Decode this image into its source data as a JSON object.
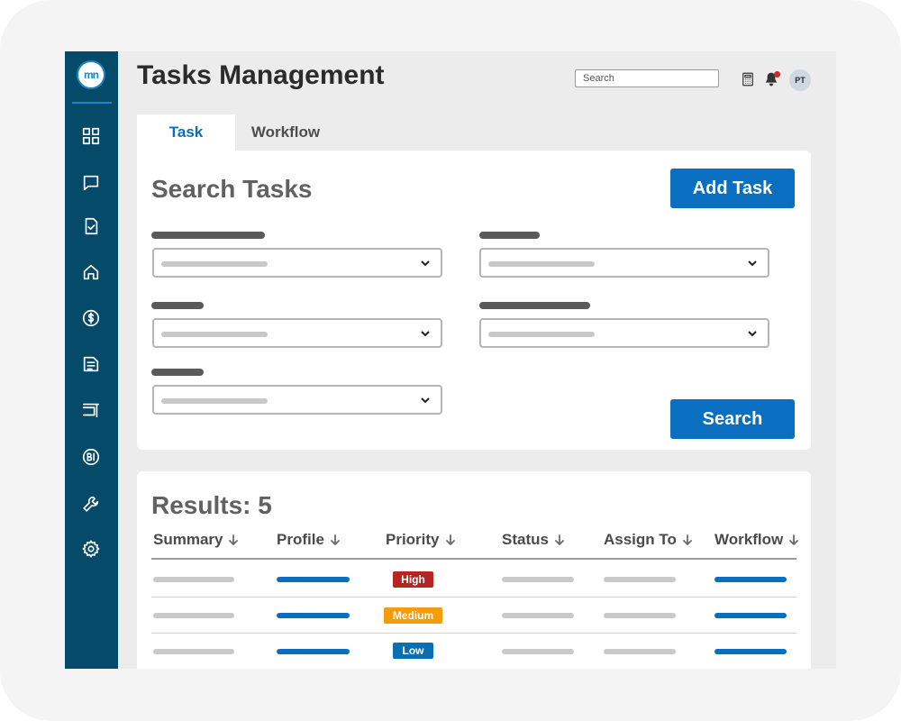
{
  "app": {
    "logo_text": "mn",
    "title": "Tasks Management"
  },
  "header": {
    "search_placeholder": "Search",
    "avatar_initials": "PT",
    "icons": [
      "calculator-icon",
      "bell-icon"
    ]
  },
  "sidebar": {
    "items": [
      {
        "name": "dashboard",
        "icon": "grid-icon"
      },
      {
        "name": "messages",
        "icon": "chat-icon"
      },
      {
        "name": "tasks",
        "icon": "checklist-icon"
      },
      {
        "name": "property",
        "icon": "home-icon"
      },
      {
        "name": "finance",
        "icon": "dollar-icon"
      },
      {
        "name": "documents",
        "icon": "document-icon"
      },
      {
        "name": "inventory",
        "icon": "cabinet-icon"
      },
      {
        "name": "bi",
        "icon": "bi-icon"
      },
      {
        "name": "tools",
        "icon": "wrench-icon"
      },
      {
        "name": "settings",
        "icon": "gear-icon"
      }
    ]
  },
  "tabs": [
    {
      "label": "Task",
      "active": true
    },
    {
      "label": "Workflow",
      "active": false
    }
  ],
  "search_card": {
    "title": "Search Tasks",
    "add_button": "Add Task",
    "search_button": "Search"
  },
  "results": {
    "title": "Results: 5",
    "columns": [
      "Summary",
      "Profile",
      "Priority",
      "Status",
      "Assign To",
      "Workflow"
    ],
    "rows": [
      {
        "priority": "High"
      },
      {
        "priority": "Medium"
      },
      {
        "priority": "Low"
      }
    ]
  },
  "colors": {
    "sidebar": "#064a69",
    "accent": "#0a6fc0",
    "priority_high": "#b5261e",
    "priority_medium": "#f59c0b",
    "priority_low": "#0a6fb0"
  }
}
